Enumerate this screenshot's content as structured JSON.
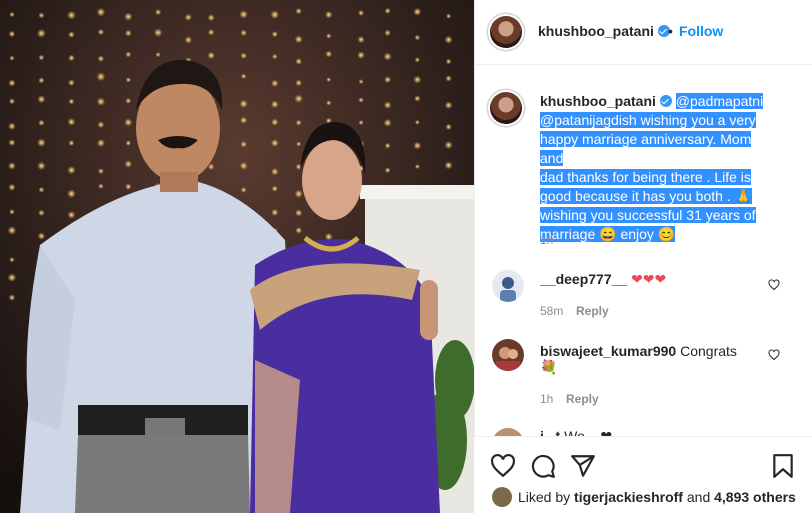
{
  "post": {
    "username": "khushboo_patani",
    "follow_label": "Follow",
    "separator": "•"
  },
  "caption": {
    "username": "khushboo_patani",
    "line1": "@padmapatni",
    "line2": "@patanijagdish wishing you a very",
    "line3": "happy marriage anniversary. Mom and",
    "line4": "dad thanks for being there . Life is",
    "line5": "good because it has you both . 🙏",
    "line6": "wishing you successful 31 years of",
    "line7": "marriage 😄 enjoy 😊",
    "time": "1h"
  },
  "comments": [
    {
      "username": "__deep777__",
      "text": "❤❤❤",
      "time": "58m",
      "reply_label": "Reply"
    },
    {
      "username": "biswajeet_kumar990",
      "text": "Congrats",
      "emoji": "💐",
      "time": "1h",
      "reply_label": "Reply"
    },
    {
      "username": "i...t",
      "text": "Wo... ❤"
    }
  ],
  "likes": {
    "prefix": "Liked by",
    "user": "tigerjackieshroff",
    "joiner": "and",
    "others": "4,893 others"
  },
  "colors": {
    "accent": "#0095f6",
    "selection": "#3390ff",
    "heart": "#ed4956"
  },
  "icons": [
    "verified-badge-icon",
    "heart-icon",
    "comment-icon",
    "share-icon",
    "bookmark-icon"
  ]
}
